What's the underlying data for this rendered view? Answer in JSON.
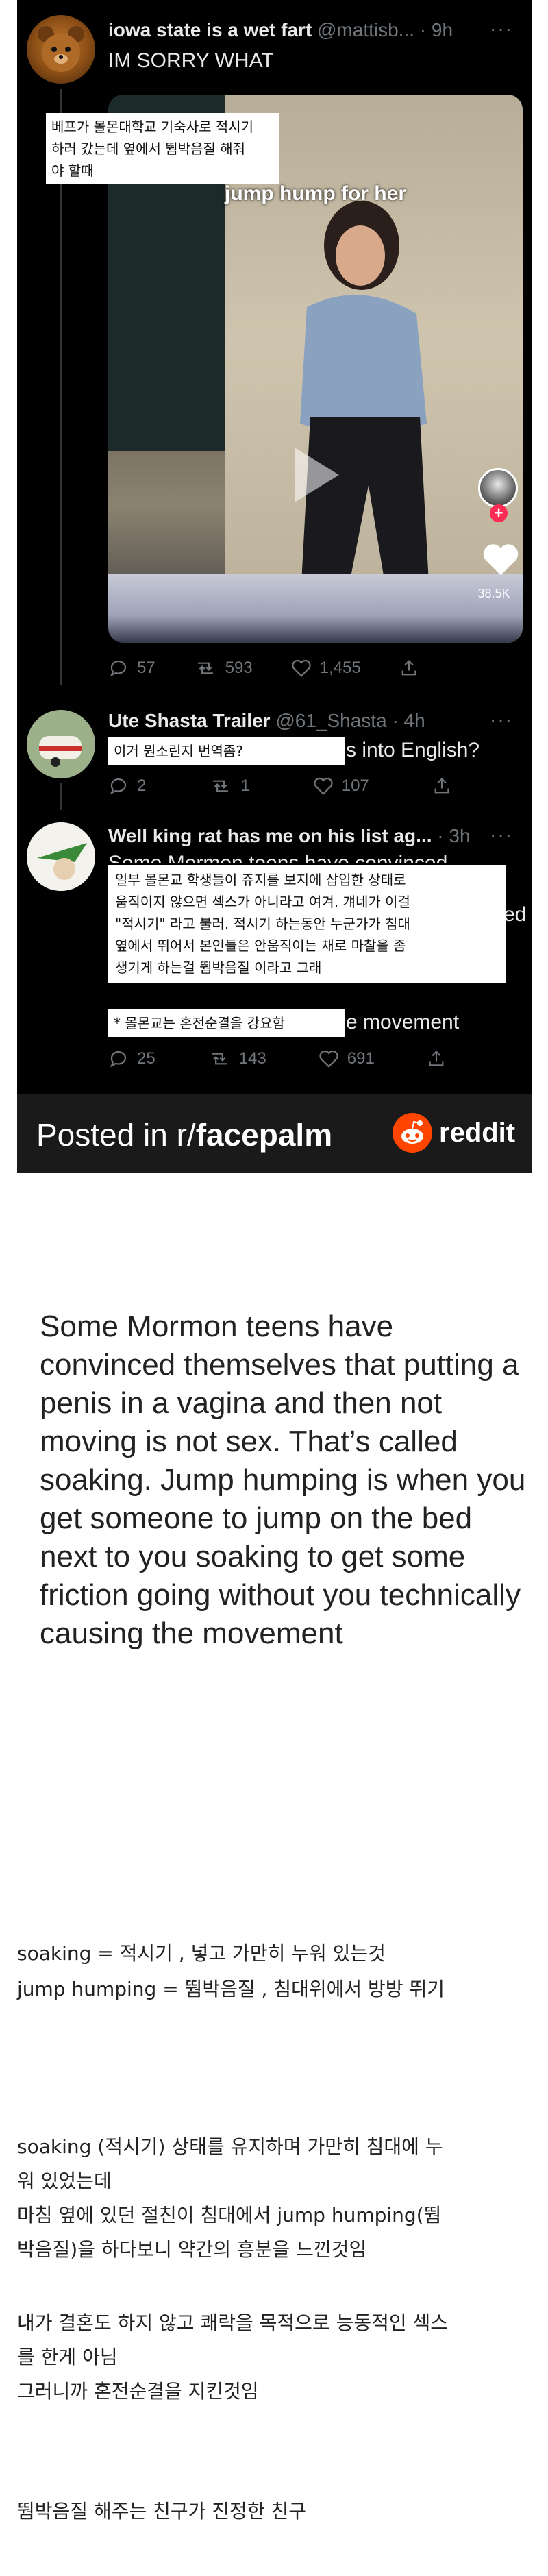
{
  "tweets": [
    {
      "name": "iowa state is a wet fart",
      "handle": "@mattisb...",
      "time": "· 9h",
      "text": "IM SORRY WHAT",
      "actions": {
        "replies": "57",
        "retweets": "593",
        "likes": "1,455"
      }
    },
    {
      "name": "Ute Shasta Trailer",
      "handle": "@61_Shasta",
      "time": "· 4h",
      "text_tail": "s into English?",
      "actions": {
        "replies": "2",
        "retweets": "1",
        "likes": "107"
      }
    },
    {
      "name": "Well king rat has me on his list ag...",
      "time": "· 3h",
      "text_partial_top": "Some Mormon teens have convinced",
      "text_tail_right": "ed",
      "text_tail_bottom": "e movement",
      "actions": {
        "replies": "25",
        "retweets": "143",
        "likes": "691"
      }
    }
  ],
  "video": {
    "caption": "jump hump for her",
    "likes": "38.5K"
  },
  "notes": {
    "note1": [
      "베프가 몰몬대학교 기숙사로 적시기",
      "하러 갔는데 옆에서 뛈박음질 해줘",
      "야 할때"
    ],
    "note2": "이거 뭔소린지 번역좀?",
    "note3": [
      "일부 몰몬교 학생들이 쥬지를 보지에 삽입한 상태로",
      "움직이지 않으면 섹스가 아니라고 여겨. 걔네가 이걸",
      "\"적시기\" 라고 불러. 적시기 하는동안 누군가가 침대",
      "옆에서 뛰어서 본인들은 안움직이는 채로 마찰을 좀",
      "생기게 하는걸 뛈박음질 이라고 그래"
    ],
    "note4": "* 몰몬교는 혼전순결을 강요함"
  },
  "footer": {
    "posted_in": "Posted in r/",
    "subreddit": "facepalm",
    "brand": "reddit"
  },
  "body": {
    "english": "Some Mormon teens have convinced themselves that putting a penis in a vagina and then not moving is not sex. That’s called soaking. Jump humping is when you get someone to jump on the bed next to you soaking to get some friction going without you technically causing the movement",
    "gloss": [
      "soaking  = 적시기 , 넣고 가만히 누워 있는것",
      "jump humping  =  뛈박음질 ,  침대위에서 방방 뛰기"
    ],
    "para1": [
      "soaking (적시기) 상태를 유지하며 가만히 침대에 누",
      "워 있었는데",
      "마침 옆에 있던 절친이 침대에서  jump humping(뛈",
      "박음질)을 하다보니  약간의 흥분을 느낀것임"
    ],
    "para2": [
      "내가 결혼도 하지 않고 쾌락을 목적으로 능동적인 섹스",
      "를 한게 아님",
      "그러니까 혼전순결을 지킨것임"
    ],
    "closing": "뛈박음질 해주는 친구가 진정한 친구"
  },
  "colors": {
    "card_bg": "#000000",
    "footer_bg": "#1a1a1b",
    "reddit_orange": "#ff4500",
    "tiktok_red": "#fe2c55"
  }
}
